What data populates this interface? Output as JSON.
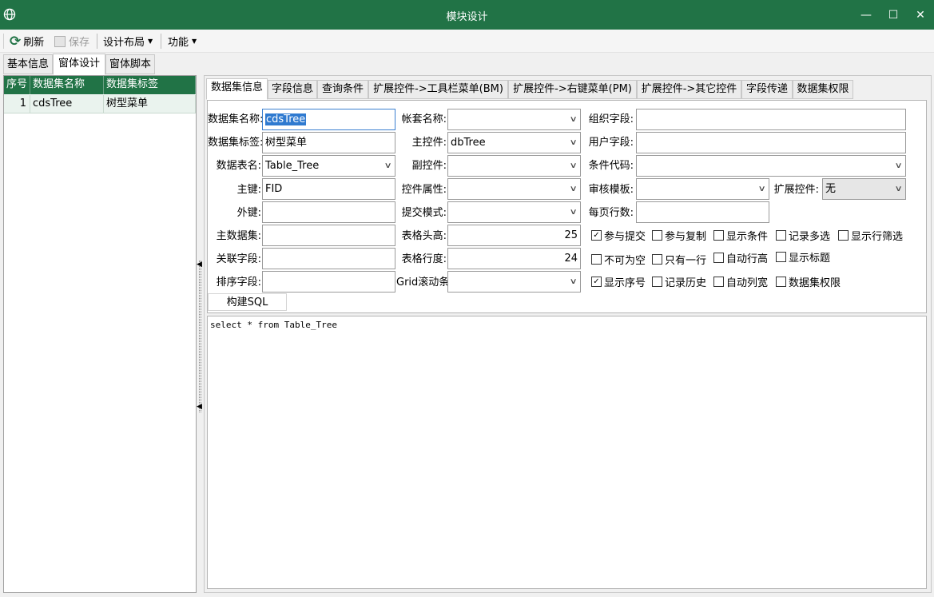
{
  "window": {
    "title": "模块设计",
    "minimize": "—",
    "maximize": "☐",
    "close": "✕"
  },
  "toolbar": {
    "refresh": "刷新",
    "save": "保存",
    "design_layout": "设计布局",
    "function": "功能"
  },
  "main_tabs": [
    "基本信息",
    "窗体设计",
    "窗体脚本"
  ],
  "dataset_grid": {
    "headers": [
      "序号",
      "数据集名称",
      "数据集标签"
    ],
    "rows": [
      {
        "index": "1",
        "name": "cdsTree",
        "label": "树型菜单"
      }
    ]
  },
  "sub_tabs": [
    "数据集信息",
    "字段信息",
    "查询条件",
    "扩展控件->工具栏菜单(BM)",
    "扩展控件->右键菜单(PM)",
    "扩展控件->其它控件",
    "字段传递",
    "数据集权限"
  ],
  "form": {
    "col1": {
      "dataset_name": {
        "label": "数据集名称:",
        "value": "cdsTree"
      },
      "dataset_label": {
        "label": "数据集标签:",
        "value": "树型菜单"
      },
      "table_name": {
        "label": "数据表名:",
        "value": "Table_Tree"
      },
      "primary_key": {
        "label": "主键:",
        "value": "FID"
      },
      "foreign_key": {
        "label": "外键:",
        "value": ""
      },
      "master_dataset": {
        "label": "主数据集:",
        "value": ""
      },
      "link_field": {
        "label": "关联字段:",
        "value": ""
      },
      "sort_field": {
        "label": "排序字段:",
        "value": ""
      }
    },
    "col2": {
      "account_name": {
        "label": "帐套名称:",
        "value": ""
      },
      "main_control": {
        "label": "主控件:",
        "value": "dbTree"
      },
      "sub_control": {
        "label": "副控件:",
        "value": ""
      },
      "control_attr": {
        "label": "控件属性:",
        "value": ""
      },
      "submit_mode": {
        "label": "提交模式:",
        "value": ""
      },
      "header_height": {
        "label": "表格头高:",
        "value": "25"
      },
      "row_height": {
        "label": "表格行度:",
        "value": "24"
      },
      "grid_scrollbar": {
        "label": "Grid滚动条:",
        "value": ""
      }
    },
    "col3": {
      "org_field": {
        "label": "组织字段:",
        "value": ""
      },
      "user_field": {
        "label": "用户字段:",
        "value": ""
      },
      "condition_code": {
        "label": "条件代码:",
        "value": ""
      },
      "audit_template": {
        "label": "审核模板:",
        "value": ""
      },
      "page_rows": {
        "label": "每页行数:",
        "value": ""
      },
      "ext_control": {
        "label": "扩展控件:",
        "value": "无"
      }
    },
    "checkboxes": [
      [
        {
          "label": "参与提交",
          "checked": true
        },
        {
          "label": "参与复制",
          "checked": false
        },
        {
          "label": "显示条件",
          "checked": false
        },
        {
          "label": "记录多选",
          "checked": false
        },
        {
          "label": "显示行筛选",
          "checked": false
        }
      ],
      [
        {
          "label": "不可为空",
          "checked": false
        },
        {
          "label": "只有一行",
          "checked": false
        },
        {
          "label": "自动行高",
          "checked": false
        },
        {
          "label": "显示标题",
          "checked": false
        }
      ],
      [
        {
          "label": "显示序号",
          "checked": true
        },
        {
          "label": "记录历史",
          "checked": false
        },
        {
          "label": "自动列宽",
          "checked": false
        },
        {
          "label": "数据集权限",
          "checked": false
        }
      ]
    ],
    "build_sql": "构建SQL"
  },
  "sql": "select * from Table_Tree",
  "colors": {
    "accent": "#217346",
    "selection": "#2f7ad0"
  }
}
